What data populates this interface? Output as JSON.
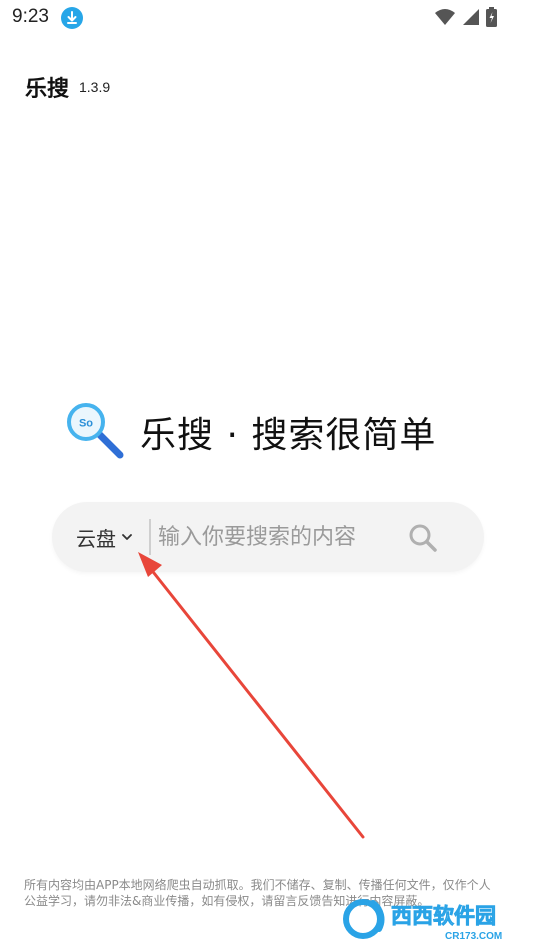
{
  "status_bar": {
    "time": "9:23",
    "icons": [
      "download-icon",
      "wifi-icon",
      "signal-icon",
      "battery-icon"
    ]
  },
  "app": {
    "title": "乐搜",
    "version": "1.3.9"
  },
  "hero": {
    "logo_icon": "magnifier-icon",
    "logo_text": "So",
    "slogan": "乐搜 · 搜索很简单"
  },
  "search": {
    "category": "云盘",
    "placeholder": "输入你要搜索的内容",
    "value": ""
  },
  "footer": {
    "disclaimer": "所有内容均由APP本地网络爬虫自动抓取。我们不储存、复制、传播任何文件，仅作个人公益学习，请勿非法&商业传播，如有侵权，请留言反馈告知进行内容屏蔽。"
  },
  "watermark": {
    "text": "西西软件园",
    "sub": "CR173.COM"
  },
  "colors": {
    "accent_blue": "#27a6e8",
    "arrow_red": "#e8463a",
    "search_bg": "#f3f3f3"
  }
}
